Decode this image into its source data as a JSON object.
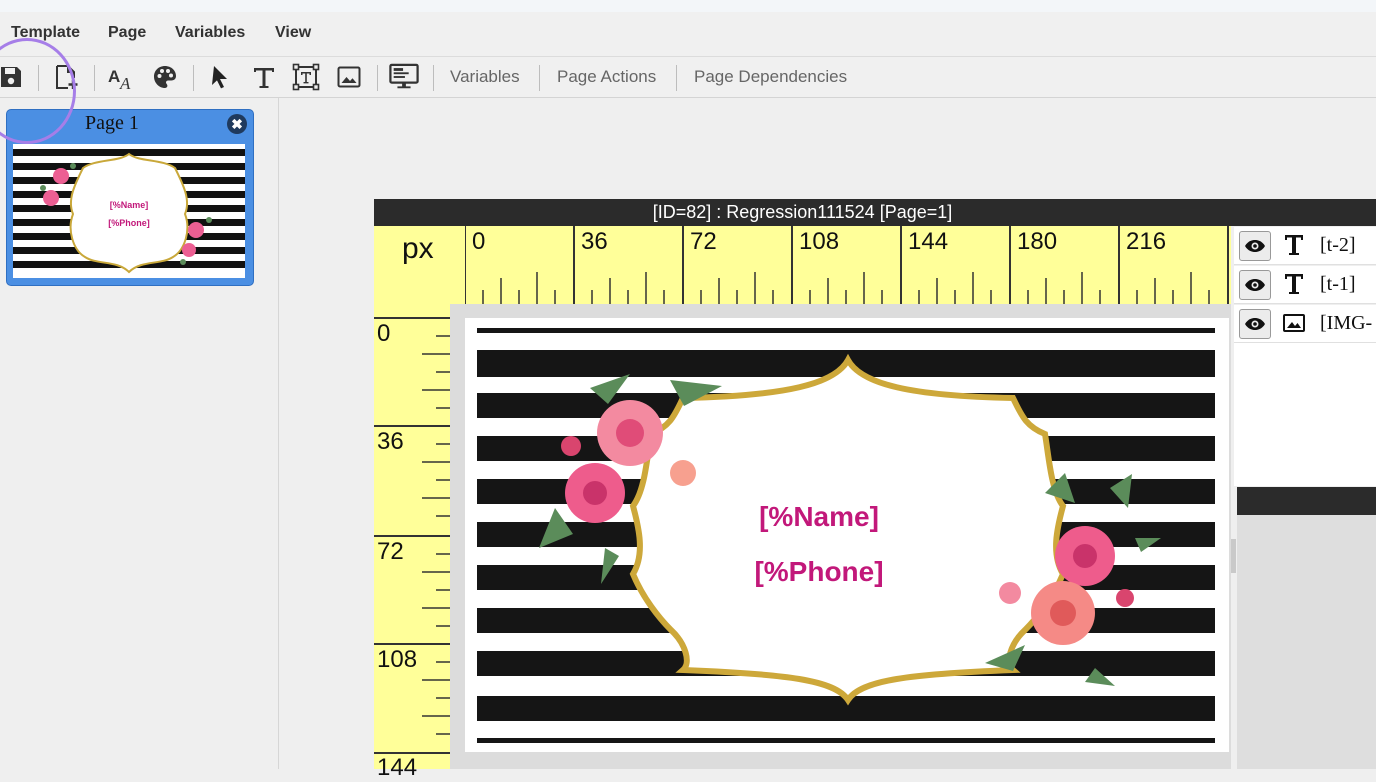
{
  "menu": {
    "template": "Template",
    "page": "Page",
    "variables": "Variables",
    "view": "View"
  },
  "toolbar": {
    "variables": "Variables",
    "page_actions": "Page Actions",
    "page_dependencies": "Page Dependencies"
  },
  "pages": {
    "page1_label": "Page 1",
    "close_glyph": "✖"
  },
  "document": {
    "title": "[ID=82] : Regression111524 [Page=1]",
    "unit": "px",
    "h_ticks": [
      "0",
      "36",
      "72",
      "108",
      "144",
      "180",
      "216"
    ],
    "v_ticks": [
      "0",
      "36",
      "72",
      "108",
      "144"
    ]
  },
  "card": {
    "name": "[%Name]",
    "phone": "[%Phone]",
    "text_color": "#c2187a"
  },
  "layers": {
    "items": [
      {
        "type": "text",
        "name": "[t-2]"
      },
      {
        "type": "text",
        "name": "[t-1]"
      },
      {
        "type": "image",
        "name": "[IMG-"
      }
    ]
  },
  "icons": {
    "save": "save-icon",
    "new_page": "new-page-icon",
    "font": "font-icon",
    "palette": "palette-icon",
    "select": "pointer-icon",
    "text": "text-icon",
    "textbox": "textbox-icon",
    "image": "image-icon",
    "preview": "preview-icon"
  }
}
